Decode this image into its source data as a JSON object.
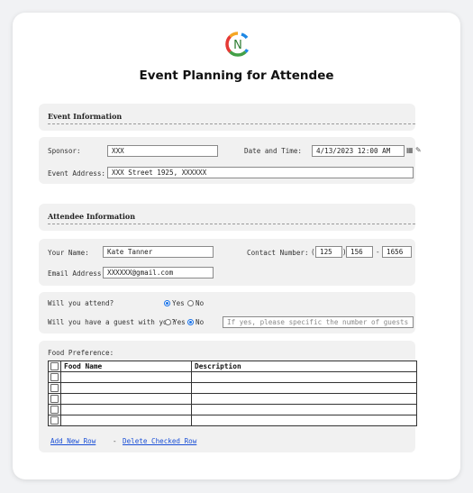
{
  "title": "Event Planning for Attendee",
  "logo_letter": "N",
  "colors": {
    "accent": "#1a73e8",
    "link": "#1a4fd6",
    "panel": "#f1f1f1"
  },
  "event_info": {
    "heading": "Event Information",
    "sponsor_label": "Sponsor:",
    "sponsor_value": "XXX",
    "datetime_label": "Date and Time:",
    "datetime_value": "4/13/2023 12:00 AM",
    "address_label": "Event Address:",
    "address_value": "XXX Street 1925, XXXXXX",
    "calendar_icon": "calendar-icon",
    "edit_icon": "pencil-icon"
  },
  "attendee_info": {
    "heading": "Attendee Information",
    "name_label": "Your Name:",
    "name_value": "Kate Tanner",
    "contact_label": "Contact Number:",
    "phone_area_open": "(",
    "phone_area": "125",
    "phone_area_close": ")",
    "phone_prefix": "156",
    "phone_dash": "-",
    "phone_line": "1656",
    "email_label": "Email Address:",
    "email_value": "XXXXXX@gmail.com"
  },
  "attendance": {
    "attend_label": "Will you attend?",
    "attend_yes": "Yes",
    "attend_no": "No",
    "attend_selected": "Yes",
    "guest_label": "Will you have a guest with you?",
    "guest_yes": "Yes",
    "guest_no": "No",
    "guest_selected": "No",
    "guest_count_placeholder": "If yes, please specific the number of guests"
  },
  "food": {
    "heading": "Food Preference:",
    "columns": [
      "Food Name",
      "Description"
    ],
    "rows": [
      {
        "name": "",
        "description": ""
      },
      {
        "name": "",
        "description": ""
      },
      {
        "name": "",
        "description": ""
      },
      {
        "name": "",
        "description": ""
      },
      {
        "name": "",
        "description": ""
      }
    ],
    "add_link": "Add New Row",
    "link_separator": "-",
    "delete_link": "Delete Checked Row"
  }
}
